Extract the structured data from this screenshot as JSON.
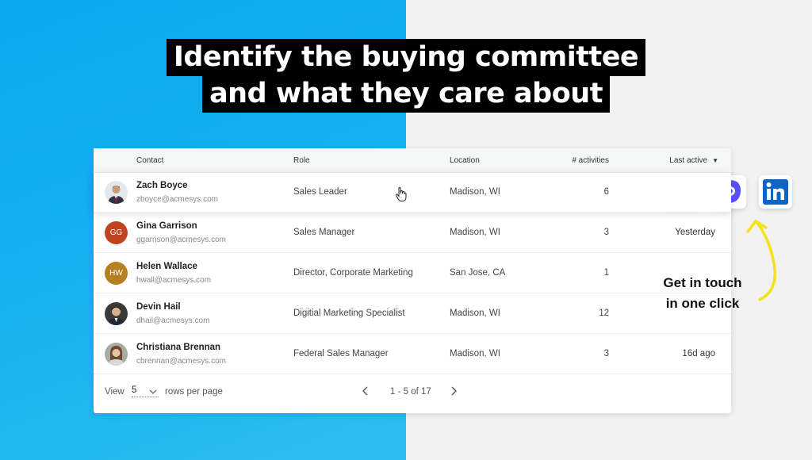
{
  "headline": {
    "line1": "Identify the buying committee",
    "line2": "and what they care about"
  },
  "table": {
    "columns": {
      "contact": "Contact",
      "role": "Role",
      "location": "Location",
      "activities": "# activities",
      "last_active": "Last active"
    },
    "rows": [
      {
        "name": "Zach Boyce",
        "email": "zboyce@acmesys.com",
        "role": "Sales Leader",
        "location": "Madison, WI",
        "activities": "6",
        "last_active": "",
        "initials": "",
        "avatar_color": "#d9dee3"
      },
      {
        "name": "Gina Garrison",
        "email": "ggarrison@acmesys.com",
        "role": "Sales Manager",
        "location": "Madison, WI",
        "activities": "3",
        "last_active": "Yesterday",
        "initials": "GG",
        "avatar_color": "#c0441f"
      },
      {
        "name": "Helen Wallace",
        "email": "hwall@acmesys.com",
        "role": "Director, Corporate Marketing",
        "location": "San Jose, CA",
        "activities": "1",
        "last_active": "",
        "initials": "HW",
        "avatar_color": "#b5801f"
      },
      {
        "name": "Devin Hail",
        "email": "dhail@acmesys.com",
        "role": "Digitial Marketing Specialist",
        "location": "Madison, WI",
        "activities": "12",
        "last_active": "",
        "initials": "",
        "avatar_color": "#3a3a3a"
      },
      {
        "name": "Christiana Brennan",
        "email": "cbrennan@acmesys.com",
        "role": "Federal Sales Manager",
        "location": "Madison, WI",
        "activities": "3",
        "last_active": "16d ago",
        "initials": "",
        "avatar_color": "#8a6a4a"
      }
    ]
  },
  "pagination": {
    "view_label": "View",
    "page_size": "5",
    "rows_label": "rows per page",
    "range": "1 - 5 of 17"
  },
  "contact_icons": [
    "gmail-icon",
    "outreach-icon",
    "linkedin-icon"
  ],
  "cta": {
    "line1": "Get in touch",
    "line2": "in one click"
  },
  "colors": {
    "left_bg": "#12aeee",
    "right_bg": "#f2f2f2",
    "arrow": "#f5e21a",
    "linkedin": "#0a66c2",
    "outreach": "#5951ff",
    "gmail_red": "#d93025"
  }
}
